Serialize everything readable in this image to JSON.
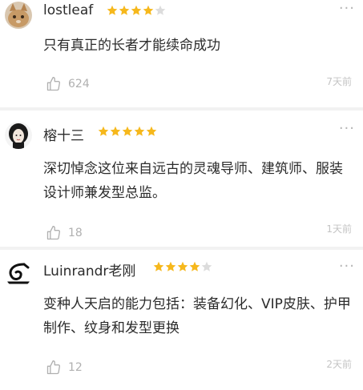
{
  "comments": [
    {
      "username": "lostleaf",
      "rating": 4,
      "text": "只有真正的长者才能续命成功",
      "likes": "624",
      "time": "7天前",
      "more": "···"
    },
    {
      "username": "榕十三",
      "rating": 5,
      "text": "深切悼念这位来自远古的灵魂导师、建筑师、服装设计师兼发型总监。",
      "likes": "18",
      "time": "1天前",
      "more": "···"
    },
    {
      "username": "Luinrandr老刚",
      "rating": 4,
      "text": "变种人天启的能力包括：装备幻化、VIP皮肤、护甲制作、纹身和发型更换",
      "likes": "12",
      "time": "2天前",
      "more": "···"
    }
  ],
  "colors": {
    "star_filled": "#f6b81c",
    "star_empty": "#dcdcdc",
    "muted": "#b0b0b0"
  }
}
